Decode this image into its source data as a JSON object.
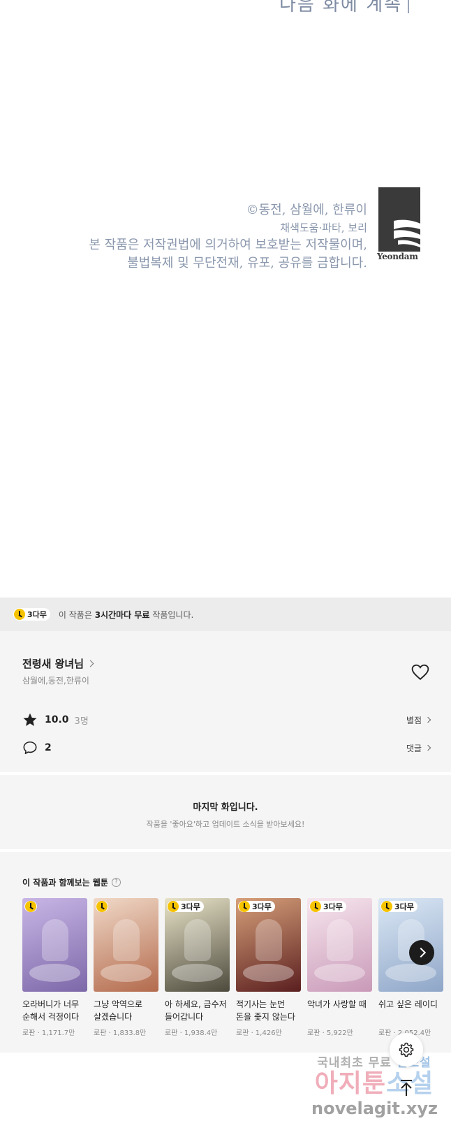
{
  "comic": {
    "next_episode": "다음 화에 계속",
    "copyright": "©동전, 삼월에, 한류이",
    "coloring": "채색도움·파타, 보리",
    "legal_line1": "본 작품은 저작권법에 의거하여 보호받는 저작물이며,",
    "legal_line2": "불법복제 및 무단전재, 유포, 공유를 금합니다.",
    "logo_text": "Yeondam"
  },
  "free_banner": {
    "badge": "3다무",
    "text_prefix": "이 작품은 ",
    "text_bold": "3시간마다 무료",
    "text_suffix": " 작품입니다."
  },
  "work": {
    "title": "전령새 왕녀님",
    "authors": "삼월에,동전,한류이",
    "rating": "10.0",
    "rating_count": "3명",
    "rating_link": "별점",
    "comment_count": "2",
    "comment_link": "댓글"
  },
  "last_episode": {
    "heading": "마지막 화입니다.",
    "subtext": "작품을 '좋아요'하고 업데이트 소식을 받아보세요!"
  },
  "recommendations": {
    "title": "이 작품과 함께보는 웹툰",
    "help": "?",
    "items": [
      {
        "title": "오라버니가 너무 순해서 걱정이다",
        "meta": "로판 · 1,171.7만",
        "badge": "",
        "color_top": "#c9b6e6",
        "color_bottom": "#7c68a8"
      },
      {
        "title": "그냥 악역으로 살겠습니다",
        "meta": "로판 · 1,833.8만",
        "badge": "",
        "color_top": "#f0d9c8",
        "color_bottom": "#b36a4c"
      },
      {
        "title": "아 하세요, 금수저 들어갑니다",
        "meta": "로판 · 1,938.4만",
        "badge": "3다무",
        "color_top": "#e9e4c8",
        "color_bottom": "#4d4a3d"
      },
      {
        "title": "적기사는 눈먼 돈을 좇지 않는다",
        "meta": "로판 · 1,426만",
        "badge": "3다무",
        "color_top": "#d7a07a",
        "color_bottom": "#5a1f1f"
      },
      {
        "title": "악녀가 사랑할 때",
        "meta": "로판 · 5,922만",
        "badge": "3다무",
        "color_top": "#f7e6ee",
        "color_bottom": "#c99ab8"
      },
      {
        "title": "쉬고 싶은 레이디",
        "meta": "로판 · 2,052.4만",
        "badge": "3다무",
        "color_top": "#dbe8f5",
        "color_bottom": "#8fa6c8"
      }
    ]
  },
  "watermark": {
    "line1_a": "국내최초 무료",
    "line1_b": "웹소설",
    "line2_a": "아지툰",
    "line2_b": "소설",
    "line3": "novelagit.xyz"
  },
  "colors": {
    "badge_yellow": "#f6c300",
    "panel_bg": "#f5f5f5",
    "banner_bg": "#ececec",
    "credit_text": "#8a97ad"
  },
  "icons": {
    "star": "star-icon",
    "comment": "comment-bubble-icon",
    "heart": "heart-outline-icon",
    "settings": "gear-icon",
    "to_top": "arrow-up-icon",
    "next": "chevron-right-icon",
    "clock": "clock-icon"
  }
}
